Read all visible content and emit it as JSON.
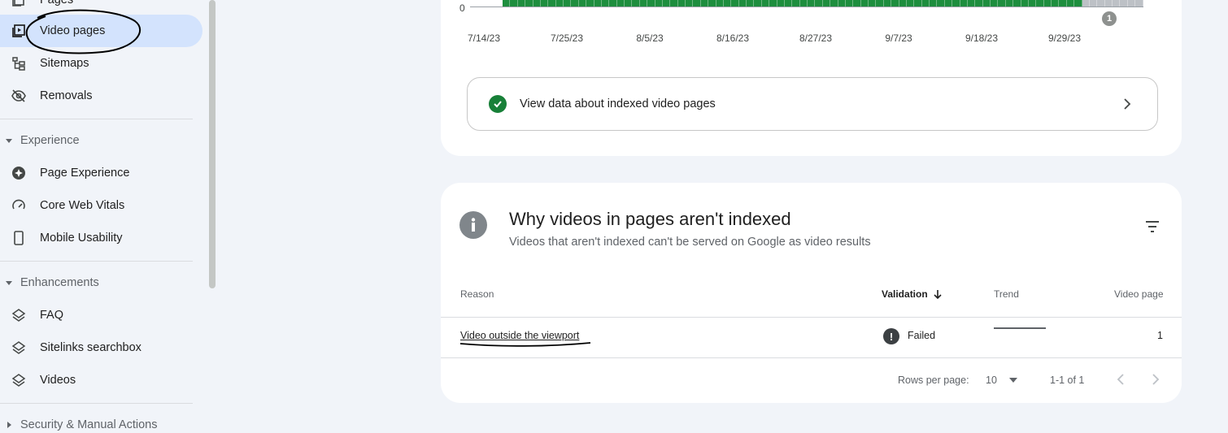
{
  "sidebar": {
    "items": [
      {
        "label": "Pages",
        "icon": "pages-icon"
      },
      {
        "label": "Video pages",
        "icon": "video-pages-icon",
        "active": true
      },
      {
        "label": "Sitemaps",
        "icon": "sitemap-icon"
      },
      {
        "label": "Removals",
        "icon": "removals-icon"
      }
    ],
    "experience": {
      "heading": "Experience",
      "items": [
        {
          "label": "Page Experience",
          "icon": "page-experience-icon"
        },
        {
          "label": "Core Web Vitals",
          "icon": "gauge-icon"
        },
        {
          "label": "Mobile Usability",
          "icon": "phone-icon"
        }
      ]
    },
    "enhancements": {
      "heading": "Enhancements",
      "items": [
        {
          "label": "FAQ",
          "icon": "layers-icon"
        },
        {
          "label": "Sitelinks searchbox",
          "icon": "layers-icon"
        },
        {
          "label": "Videos",
          "icon": "layers-icon"
        }
      ]
    },
    "security": {
      "heading": "Security & Manual Actions"
    }
  },
  "chart": {
    "zero_label": "0",
    "x_ticks": [
      "7/14/23",
      "7/25/23",
      "8/5/23",
      "8/16/23",
      "8/27/23",
      "9/7/23",
      "9/18/23",
      "9/29/23"
    ],
    "annotation_marker": "1",
    "colors": {
      "indexed": "#1e8e3e",
      "pending": "#bdc1c6"
    }
  },
  "chart_data": {
    "type": "bar",
    "title": "",
    "xlabel": "",
    "ylabel": "",
    "x_tick_labels": [
      "7/14/23",
      "7/25/23",
      "8/5/23",
      "8/16/23",
      "8/27/23",
      "9/7/23",
      "9/18/23",
      "9/29/23"
    ],
    "series": [
      {
        "name": "",
        "color": "#1e8e3e"
      },
      {
        "name": "",
        "color": "#bdc1c6"
      }
    ]
  },
  "indexed_link": {
    "label": "View data about indexed video pages"
  },
  "why_card": {
    "title": "Why videos in pages aren't indexed",
    "subtitle": "Videos that aren't indexed can't be served on Google as video results",
    "columns": {
      "reason": "Reason",
      "validation": "Validation",
      "trend": "Trend",
      "count": "Video page"
    },
    "rows": [
      {
        "reason": "Video outside the viewport",
        "validation": "Failed",
        "count": "1"
      }
    ],
    "pagination": {
      "rows_per_page_label": "Rows per page:",
      "rows_per_page": "10",
      "range": "1-1 of 1"
    }
  }
}
